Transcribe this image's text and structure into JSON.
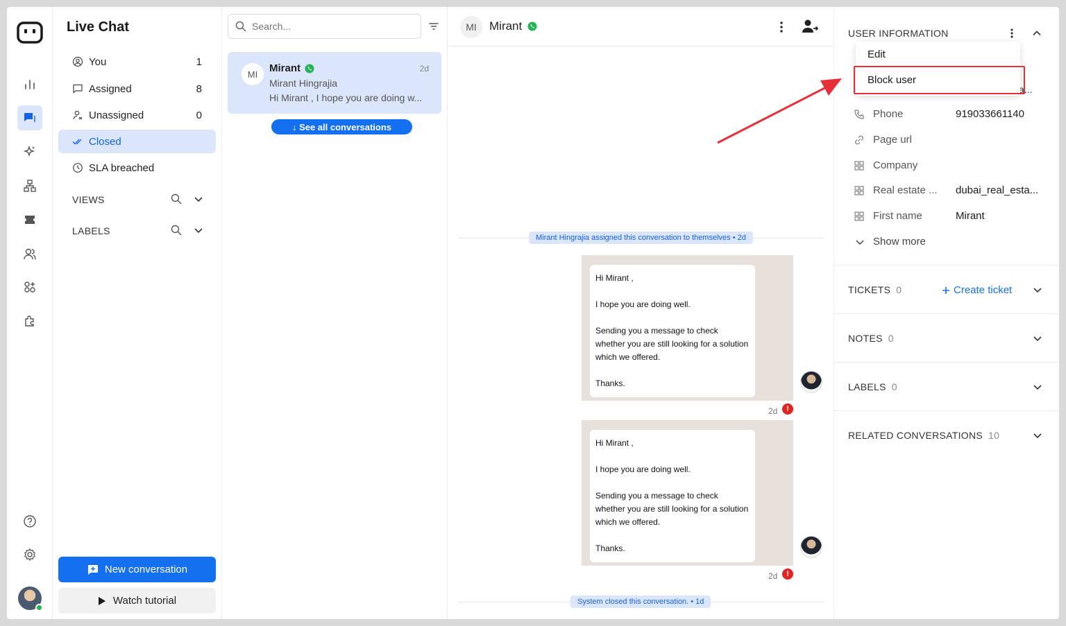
{
  "sidebar": {
    "title": "Live Chat",
    "items": [
      {
        "label": "You",
        "count": "1"
      },
      {
        "label": "Assigned",
        "count": "8"
      },
      {
        "label": "Unassigned",
        "count": "0"
      },
      {
        "label": "Closed",
        "count": ""
      },
      {
        "label": "SLA breached",
        "count": ""
      }
    ],
    "views_label": "VIEWS",
    "labels_label": "LABELS",
    "new_conversation": "New conversation",
    "watch_tutorial": "Watch tutorial"
  },
  "conversation_list": {
    "search_placeholder": "Search...",
    "card": {
      "initials": "MI",
      "name": "Mirant",
      "subtitle": "Mirant Hingrajia",
      "preview": "Hi Mirant , I hope you are doing w...",
      "time": "2d"
    },
    "see_all": "↓ See all conversations"
  },
  "chat": {
    "header": {
      "initials": "MI",
      "name": "Mirant"
    },
    "system_assigned": "Mirant Hingrajia assigned this conversation to themselves  •  2d",
    "system_closed": "System closed this conversation.  •  1d",
    "messages": [
      {
        "line1": "Hi Mirant ,",
        "line2": "I hope you are doing well.",
        "line3": "Sending you a message to check whether you are still looking for a solution which we offered.",
        "line4": "Thanks.",
        "time": "2d"
      },
      {
        "line1": "Hi Mirant ,",
        "line2": "I hope you are doing well.",
        "line3": "Sending you a message to check whether you are still looking for a solution which we offered.",
        "line4": "Thanks.",
        "time": "2d"
      }
    ]
  },
  "panel": {
    "user_info_title": "USER INFORMATION",
    "menu": {
      "edit": "Edit",
      "block": "Block user"
    },
    "truncated_hint": "a...",
    "fields": [
      {
        "label": "Phone",
        "value": "919033661140"
      },
      {
        "label": "Page url",
        "value": ""
      },
      {
        "label": "Company",
        "value": ""
      },
      {
        "label": "Real estate ...",
        "value": "dubai_real_esta..."
      },
      {
        "label": "First name",
        "value": "Mirant"
      }
    ],
    "show_more": "Show more",
    "sections": [
      {
        "label": "TICKETS",
        "count": "0"
      },
      {
        "label": "NOTES",
        "count": "0"
      },
      {
        "label": "LABELS",
        "count": "0"
      },
      {
        "label": "RELATED CONVERSATIONS",
        "count": "10"
      }
    ],
    "create_ticket": "Create ticket"
  },
  "colors": {
    "accent": "#1570ef",
    "active_bg": "#dbe6fb",
    "whatsapp": "#25b455",
    "annotation": "#e5303a",
    "error": "#e02424"
  }
}
